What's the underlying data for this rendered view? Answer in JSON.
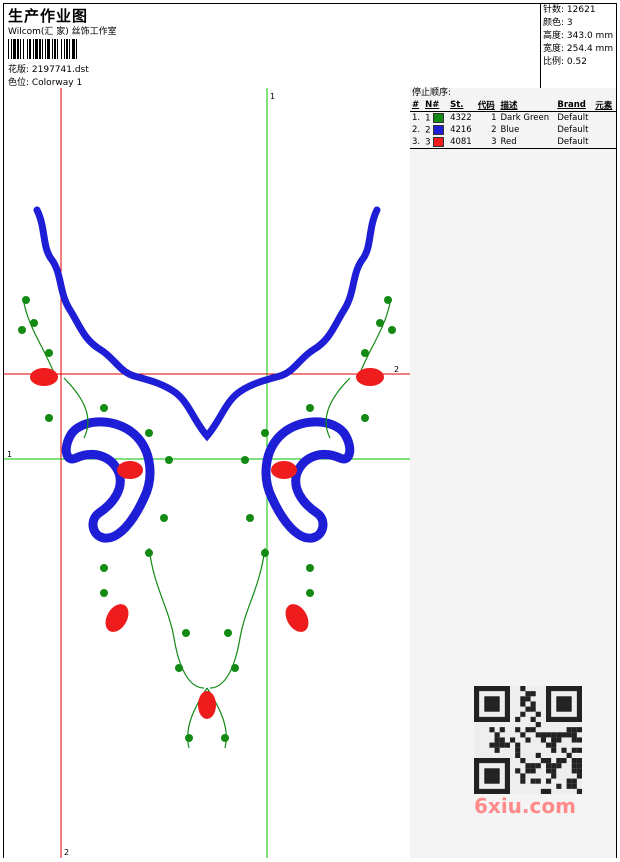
{
  "header": {
    "title": "生产作业图",
    "company": "Wilcom(汇 家) 丝饰工作室",
    "design_label": "花版: 2197741.dst",
    "colorway_label": "色位: Colorway 1"
  },
  "stats": [
    {
      "label": "针数",
      "value": "12621"
    },
    {
      "label": "颜色",
      "value": "3"
    },
    {
      "label": "高度",
      "value": "343.0 mm"
    },
    {
      "label": "宽度",
      "value": "254.4 mm"
    },
    {
      "label": "比例",
      "value": "0.52"
    }
  ],
  "sequence": {
    "title": "停止顺序:",
    "columns": [
      "#",
      "N#",
      "St.",
      "代码",
      "描述",
      "Brand",
      "元素"
    ],
    "rows": [
      {
        "n": "1.",
        "seq": "1",
        "st": "4322",
        "code": "1",
        "desc": "Dark Green",
        "brand": "Default",
        "color": "#138a13"
      },
      {
        "n": "2.",
        "seq": "2",
        "st": "4216",
        "code": "2",
        "desc": "Blue",
        "brand": "Default",
        "color": "#1e1ed6"
      },
      {
        "n": "3.",
        "seq": "3",
        "st": "4081",
        "code": "3",
        "desc": "Red",
        "brand": "Default",
        "color": "#ee1c1c"
      }
    ]
  },
  "guides": {
    "v1": "1",
    "h1": "1",
    "h2": "2",
    "v2": "2"
  },
  "watermark": "6xiu.com",
  "colors": {
    "green": "#138a13",
    "blue": "#1e1ed6",
    "red": "#ee1c1c",
    "guide_red": "#e00000",
    "guide_green": "#00c000"
  }
}
